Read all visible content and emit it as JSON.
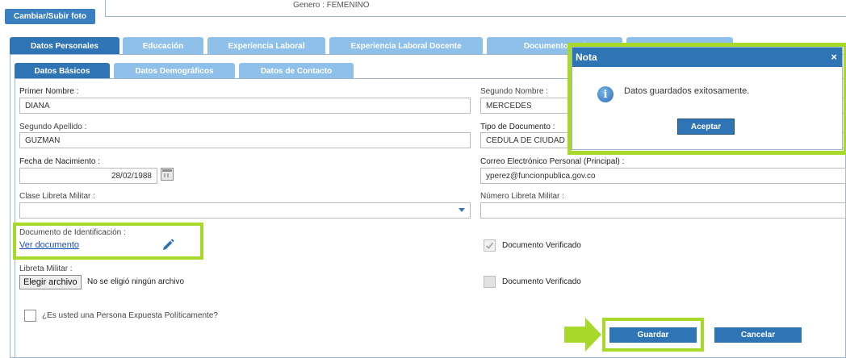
{
  "header": {
    "photo_button": "Cambiar/Subir foto",
    "genero_partial": "Genero :   FEMENINO"
  },
  "main_tabs": [
    {
      "label": "Datos Personales",
      "active": true
    },
    {
      "label": "Educación",
      "active": false
    },
    {
      "label": "Experiencia Laboral",
      "active": false
    },
    {
      "label": "Experiencia Laboral Docente",
      "active": false
    },
    {
      "label": "Documentos Ad",
      "active": false
    },
    {
      "label": "",
      "active": false
    }
  ],
  "sub_tabs": [
    {
      "label": "Datos Básicos",
      "active": true
    },
    {
      "label": "Datos Demográficos",
      "active": false
    },
    {
      "label": "Datos de Contacto",
      "active": false
    }
  ],
  "form": {
    "primer_nombre": {
      "label": "Primer Nombre :",
      "value": "DIANA"
    },
    "segundo_nombre": {
      "label": "Segundo Nombre :",
      "value": "MERCEDES"
    },
    "segundo_apellido": {
      "label": "Segundo Apellido :",
      "value": "GUZMAN"
    },
    "tipo_documento": {
      "label": "Tipo de Documento :",
      "value": "CEDULA DE CIUDAD"
    },
    "fecha_nacimiento": {
      "label": "Fecha de Nacimiento :",
      "value": "28/02/1988"
    },
    "correo": {
      "label": "Correo Electrónico Personal (Principal) :",
      "value": "yperez@funcionpublica.gov.co"
    },
    "clase_libreta": {
      "label": "Clase Libreta Militar :",
      "value": ""
    },
    "numero_libreta": {
      "label": "Número Libreta Militar :",
      "value": ""
    },
    "documento_identificacion": {
      "label": "Documento de Identificación :",
      "link": "Ver documento"
    },
    "documento_verificado_1": {
      "label": "Documento Verificado",
      "checked": true
    },
    "libreta_militar": {
      "label": "Libreta Militar :",
      "file_button": "Elegir archivo",
      "file_status": "No se eligió ningún archivo"
    },
    "documento_verificado_2": {
      "label": "Documento Verificado",
      "checked": false
    },
    "pep": {
      "label": "¿Es usted una Persona Expuesta Políticamente?",
      "checked": false
    }
  },
  "actions": {
    "guardar": "Guardar",
    "cancelar": "Cancelar"
  },
  "modal": {
    "title": "Nota",
    "close": "×",
    "message": "Datos guardados exitosamente.",
    "accept": "Aceptar",
    "icon": "info-icon"
  },
  "colors": {
    "primary": "#2f74b5",
    "tab_inactive": "#8ec0ea",
    "highlight": "#a6d92a"
  }
}
